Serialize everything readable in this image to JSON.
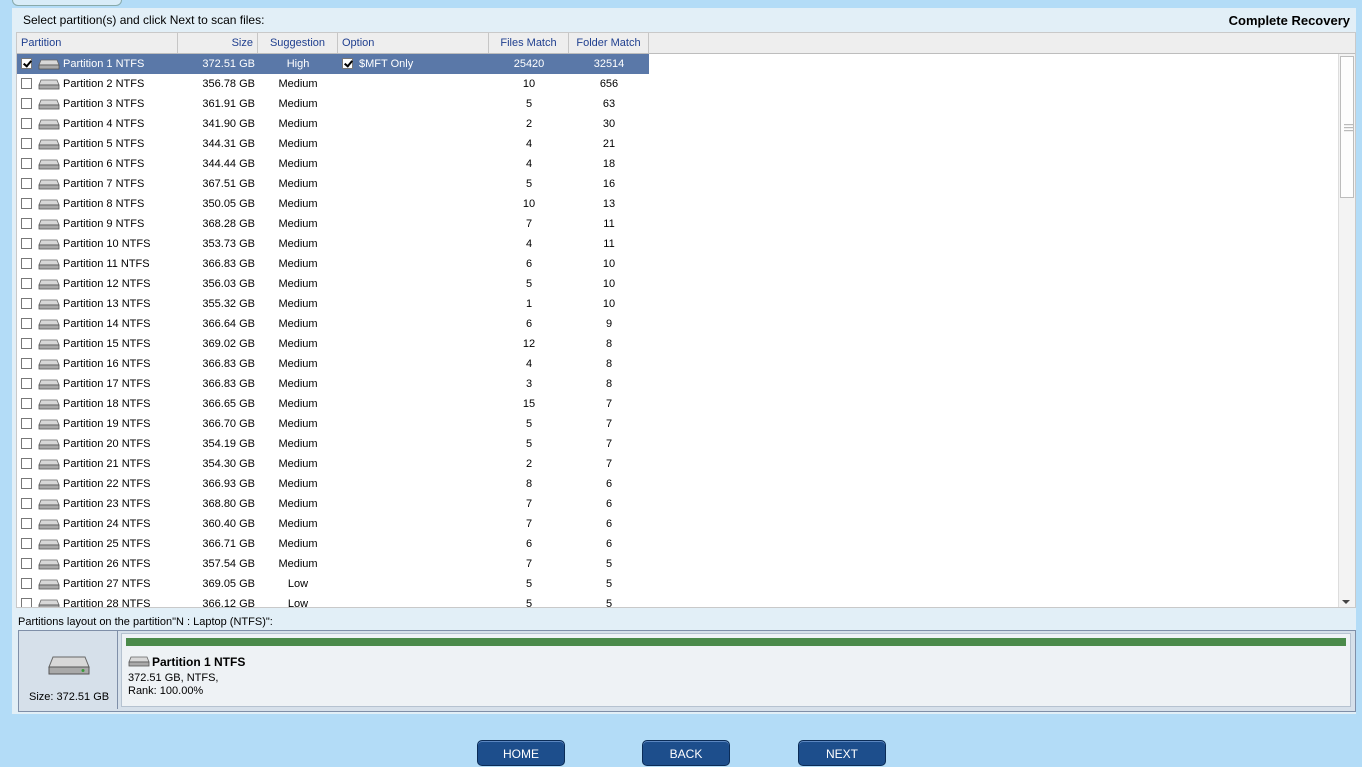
{
  "instruction": "Select  partition(s) and click Next to scan files:",
  "title": "Complete Recovery",
  "columns": {
    "partition": "Partition",
    "size": "Size",
    "suggestion": "Suggestion",
    "option": "Option",
    "files_match": "Files Match",
    "folder_match": "Folder Match"
  },
  "rows": [
    {
      "name": "Partition 1 NTFS",
      "size": "372.51 GB",
      "suggestion": "High",
      "option": "$MFT Only",
      "files": "25420",
      "folders": "32514",
      "checked": true
    },
    {
      "name": "Partition 2 NTFS",
      "size": "356.78 GB",
      "suggestion": "Medium",
      "option": "",
      "files": "10",
      "folders": "656",
      "checked": false
    },
    {
      "name": "Partition 3 NTFS",
      "size": "361.91 GB",
      "suggestion": "Medium",
      "option": "",
      "files": "5",
      "folders": "63",
      "checked": false
    },
    {
      "name": "Partition 4 NTFS",
      "size": "341.90 GB",
      "suggestion": "Medium",
      "option": "",
      "files": "2",
      "folders": "30",
      "checked": false
    },
    {
      "name": "Partition 5 NTFS",
      "size": "344.31 GB",
      "suggestion": "Medium",
      "option": "",
      "files": "4",
      "folders": "21",
      "checked": false
    },
    {
      "name": "Partition 6 NTFS",
      "size": "344.44 GB",
      "suggestion": "Medium",
      "option": "",
      "files": "4",
      "folders": "18",
      "checked": false
    },
    {
      "name": "Partition 7 NTFS",
      "size": "367.51 GB",
      "suggestion": "Medium",
      "option": "",
      "files": "5",
      "folders": "16",
      "checked": false
    },
    {
      "name": "Partition 8 NTFS",
      "size": "350.05 GB",
      "suggestion": "Medium",
      "option": "",
      "files": "10",
      "folders": "13",
      "checked": false
    },
    {
      "name": "Partition 9 NTFS",
      "size": "368.28 GB",
      "suggestion": "Medium",
      "option": "",
      "files": "7",
      "folders": "11",
      "checked": false
    },
    {
      "name": "Partition 10 NTFS",
      "size": "353.73 GB",
      "suggestion": "Medium",
      "option": "",
      "files": "4",
      "folders": "11",
      "checked": false
    },
    {
      "name": "Partition 11 NTFS",
      "size": "366.83 GB",
      "suggestion": "Medium",
      "option": "",
      "files": "6",
      "folders": "10",
      "checked": false
    },
    {
      "name": "Partition 12 NTFS",
      "size": "356.03 GB",
      "suggestion": "Medium",
      "option": "",
      "files": "5",
      "folders": "10",
      "checked": false
    },
    {
      "name": "Partition 13 NTFS",
      "size": "355.32 GB",
      "suggestion": "Medium",
      "option": "",
      "files": "1",
      "folders": "10",
      "checked": false
    },
    {
      "name": "Partition 14 NTFS",
      "size": "366.64 GB",
      "suggestion": "Medium",
      "option": "",
      "files": "6",
      "folders": "9",
      "checked": false
    },
    {
      "name": "Partition 15 NTFS",
      "size": "369.02 GB",
      "suggestion": "Medium",
      "option": "",
      "files": "12",
      "folders": "8",
      "checked": false
    },
    {
      "name": "Partition 16 NTFS",
      "size": "366.83 GB",
      "suggestion": "Medium",
      "option": "",
      "files": "4",
      "folders": "8",
      "checked": false
    },
    {
      "name": "Partition 17 NTFS",
      "size": "366.83 GB",
      "suggestion": "Medium",
      "option": "",
      "files": "3",
      "folders": "8",
      "checked": false
    },
    {
      "name": "Partition 18 NTFS",
      "size": "366.65 GB",
      "suggestion": "Medium",
      "option": "",
      "files": "15",
      "folders": "7",
      "checked": false
    },
    {
      "name": "Partition 19 NTFS",
      "size": "366.70 GB",
      "suggestion": "Medium",
      "option": "",
      "files": "5",
      "folders": "7",
      "checked": false
    },
    {
      "name": "Partition 20 NTFS",
      "size": "354.19 GB",
      "suggestion": "Medium",
      "option": "",
      "files": "5",
      "folders": "7",
      "checked": false
    },
    {
      "name": "Partition 21 NTFS",
      "size": "354.30 GB",
      "suggestion": "Medium",
      "option": "",
      "files": "2",
      "folders": "7",
      "checked": false
    },
    {
      "name": "Partition 22 NTFS",
      "size": "366.93 GB",
      "suggestion": "Medium",
      "option": "",
      "files": "8",
      "folders": "6",
      "checked": false
    },
    {
      "name": "Partition 23 NTFS",
      "size": "368.80 GB",
      "suggestion": "Medium",
      "option": "",
      "files": "7",
      "folders": "6",
      "checked": false
    },
    {
      "name": "Partition 24 NTFS",
      "size": "360.40 GB",
      "suggestion": "Medium",
      "option": "",
      "files": "7",
      "folders": "6",
      "checked": false
    },
    {
      "name": "Partition 25 NTFS",
      "size": "366.71 GB",
      "suggestion": "Medium",
      "option": "",
      "files": "6",
      "folders": "6",
      "checked": false
    },
    {
      "name": "Partition 26 NTFS",
      "size": "357.54 GB",
      "suggestion": "Medium",
      "option": "",
      "files": "7",
      "folders": "5",
      "checked": false
    },
    {
      "name": "Partition 27 NTFS",
      "size": "369.05 GB",
      "suggestion": "Low",
      "option": "",
      "files": "5",
      "folders": "5",
      "checked": false
    },
    {
      "name": "Partition 28 NTFS",
      "size": "366.12 GB",
      "suggestion": "Low",
      "option": "",
      "files": "5",
      "folders": "5",
      "checked": false
    }
  ],
  "layout": {
    "label": "Partitions layout on the partition\"N : Laptop  (NTFS)\":",
    "disk_size": "Size: 372.51 GB",
    "partition_name": "Partition 1 NTFS",
    "partition_info": "372.51 GB, NTFS,",
    "partition_rank": "Rank: 100.00%"
  },
  "buttons": {
    "home": "HOME",
    "back": "BACK",
    "next": "NEXT"
  },
  "colors": {
    "background": "#b3dcf7",
    "selected_row": "#5a78a8",
    "button": "#1d4e8c",
    "partition_bar": "#4a8a4a"
  }
}
